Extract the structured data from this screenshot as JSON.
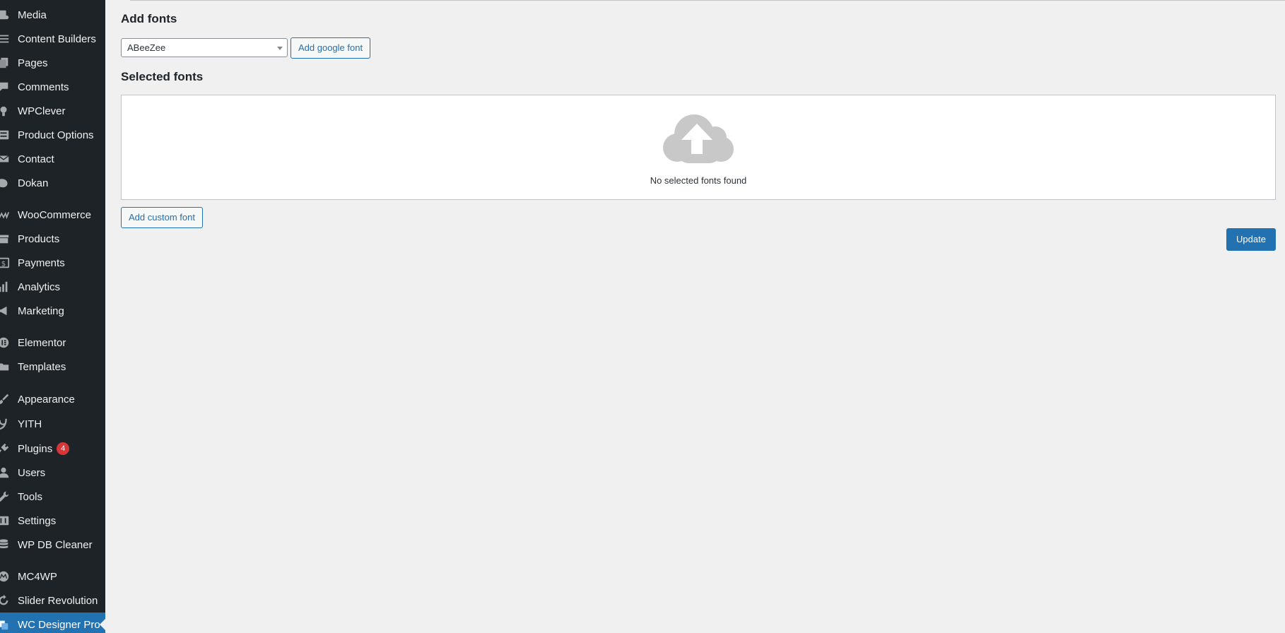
{
  "sidebar": {
    "items": [
      {
        "label": "Media",
        "icon": "media-icon"
      },
      {
        "label": "Content Builders",
        "icon": "list-icon"
      },
      {
        "label": "Pages",
        "icon": "pages-icon"
      },
      {
        "label": "Comments",
        "icon": "comment-icon"
      },
      {
        "label": "WPClever",
        "icon": "lightbulb-icon"
      },
      {
        "label": "Product Options",
        "icon": "form-icon"
      },
      {
        "label": "Contact",
        "icon": "envelope-icon"
      },
      {
        "label": "Dokan",
        "icon": "dokan-icon"
      },
      {
        "label": "WooCommerce",
        "icon": "woocommerce-icon"
      },
      {
        "label": "Products",
        "icon": "archive-icon"
      },
      {
        "label": "Payments",
        "icon": "dollar-icon"
      },
      {
        "label": "Analytics",
        "icon": "bar-chart-icon"
      },
      {
        "label": "Marketing",
        "icon": "megaphone-icon"
      },
      {
        "label": "Elementor",
        "icon": "elementor-icon"
      },
      {
        "label": "Templates",
        "icon": "folder-icon"
      },
      {
        "label": "Appearance",
        "icon": "paintbrush-icon"
      },
      {
        "label": "YITH",
        "icon": "yith-icon"
      },
      {
        "label": "Plugins",
        "icon": "plug-icon",
        "badge": "4"
      },
      {
        "label": "Users",
        "icon": "user-icon"
      },
      {
        "label": "Tools",
        "icon": "wrench-icon"
      },
      {
        "label": "Settings",
        "icon": "settings-icon"
      },
      {
        "label": "WP DB Cleaner",
        "icon": "database-icon"
      },
      {
        "label": "MC4WP",
        "icon": "mc4wp-icon"
      },
      {
        "label": "Slider Revolution",
        "icon": "refresh-icon"
      },
      {
        "label": "WC Designer Pro",
        "icon": "designer-icon",
        "current": true
      }
    ]
  },
  "main": {
    "add_fonts_heading": "Add fonts",
    "font_select_value": "ABeeZee",
    "add_google_font_label": "Add google font",
    "selected_fonts_heading": "Selected fonts",
    "empty_message": "No selected fonts found",
    "add_custom_font_label": "Add custom font",
    "update_label": "Update"
  },
  "colors": {
    "sidebar_bg": "#1d2327",
    "accent": "#2271b1",
    "badge": "#d63638",
    "page_bg": "#f0f0f1",
    "cloud": "#c8c8c8"
  }
}
